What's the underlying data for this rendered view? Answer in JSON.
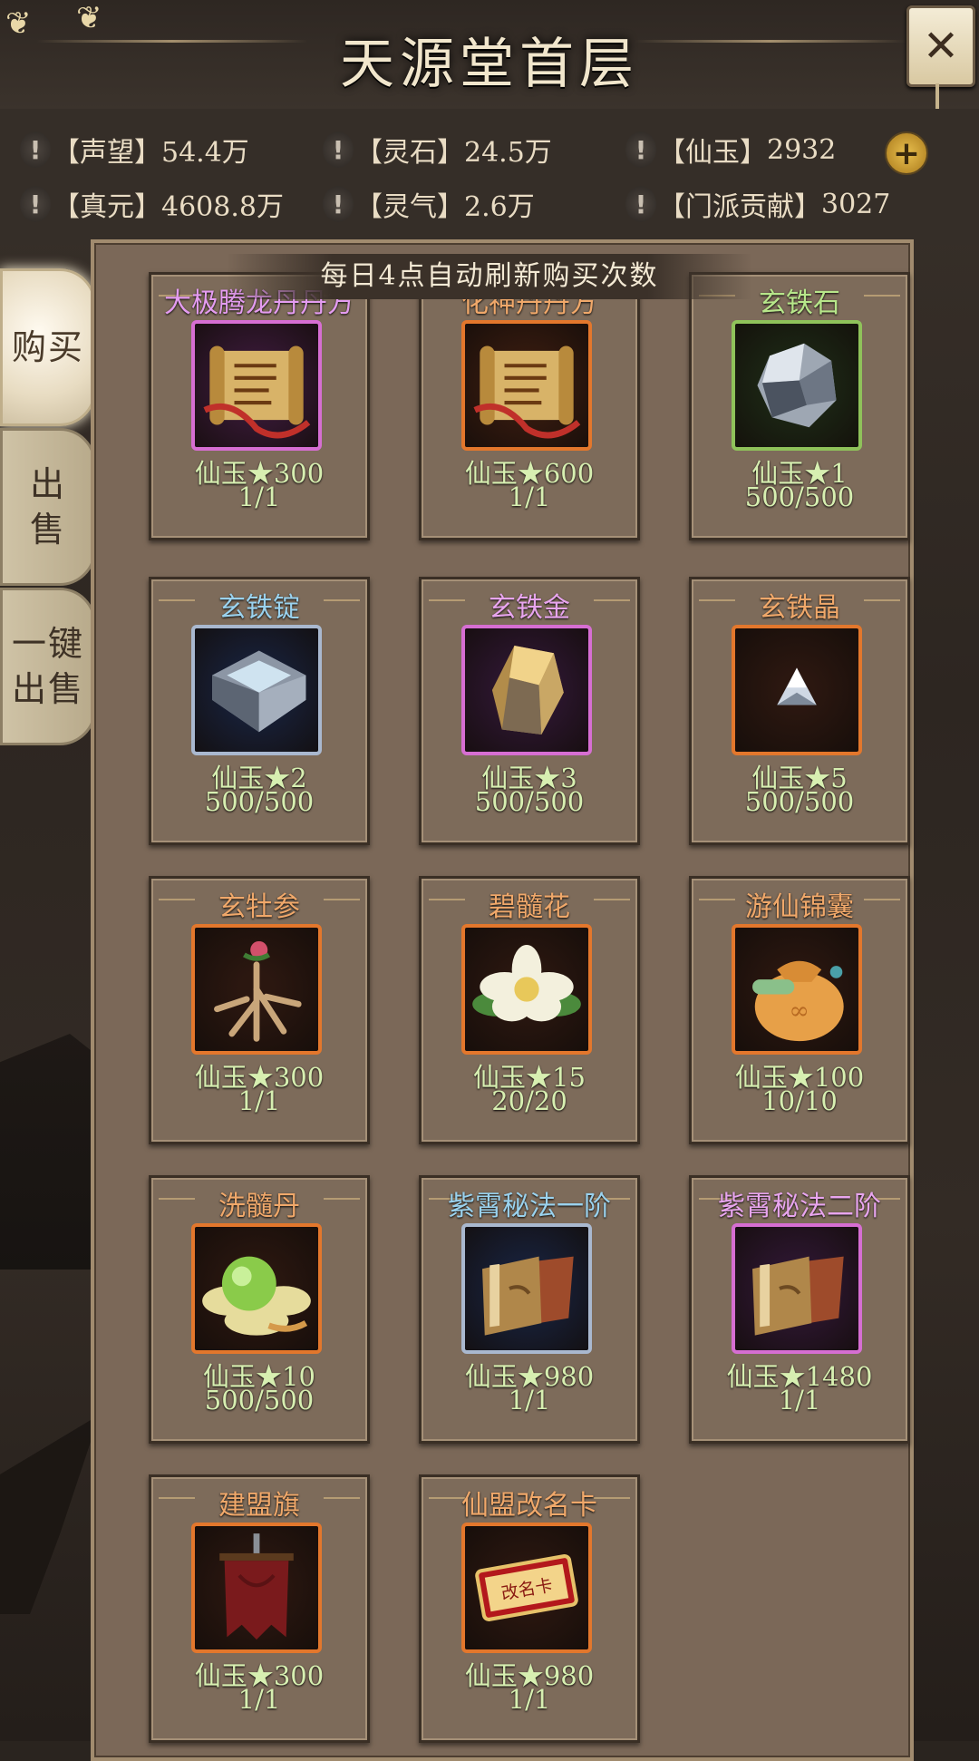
{
  "header": {
    "title": "天源堂首层",
    "close_label": "✕"
  },
  "resources": [
    {
      "name": "【声望】",
      "value": "54.4万"
    },
    {
      "name": "【灵石】",
      "value": "24.5万"
    },
    {
      "name": "【仙玉】",
      "value": "2932"
    },
    {
      "name": "【真元】",
      "value": "4608.8万"
    },
    {
      "name": "【灵气】",
      "value": "2.6万"
    },
    {
      "name": "【门派贡献】",
      "value": "3027"
    }
  ],
  "resource_alert_glyph": "!",
  "plus_label": "+",
  "tabs": {
    "buy": "购买",
    "sell": "出售",
    "onekey": "一键出售"
  },
  "tabs_lines": {
    "onekey_1": "一键",
    "onekey_2": "出售",
    "sell_1": "出",
    "sell_2": "售",
    "buy_1": "购",
    "buy_2": "买"
  },
  "notice": "每日4点自动刷新购买次数",
  "currency_label": "仙玉",
  "items": [
    {
      "name": "大极腾龙丹丹方",
      "price": "仙玉★300",
      "stock": "1/1",
      "name_color": "#e49cf0",
      "frame_color": "#d66ed2",
      "bg": "#3b1a3a",
      "icon": "scroll-icon"
    },
    {
      "name": "化神丹丹方",
      "price": "仙玉★600",
      "stock": "1/1",
      "name_color": "#f0a86a",
      "frame_color": "#e3772c",
      "bg": "#3a1c10",
      "icon": "scroll-icon"
    },
    {
      "name": "玄铁石",
      "price": "仙玉★1",
      "stock": "500/500",
      "name_color": "#b7e68a",
      "frame_color": "#8fc25a",
      "bg": "#1d2a16",
      "icon": "ore-icon"
    },
    {
      "name": "玄铁锭",
      "price": "仙玉★2",
      "stock": "500/500",
      "name_color": "#9ad2ee",
      "frame_color": "#a9b8cf",
      "bg": "#18223d",
      "icon": "ingot-icon"
    },
    {
      "name": "玄铁金",
      "price": "仙玉★3",
      "stock": "500/500",
      "name_color": "#e8a5ee",
      "frame_color": "#d66ed2",
      "bg": "#2f1733",
      "icon": "gold-ore-icon"
    },
    {
      "name": "玄铁晶",
      "price": "仙玉★5",
      "stock": "500/500",
      "name_color": "#f0a86a",
      "frame_color": "#e3772c",
      "bg": "#2b1710",
      "icon": "crystal-icon"
    },
    {
      "name": "玄牡参",
      "price": "仙玉★300",
      "stock": "1/1",
      "name_color": "#f0a86a",
      "frame_color": "#e3772c",
      "bg": "#2b1710",
      "icon": "ginseng-icon"
    },
    {
      "name": "碧髓花",
      "price": "仙玉★15",
      "stock": "20/20",
      "name_color": "#f0a86a",
      "frame_color": "#e3772c",
      "bg": "#2b1710",
      "icon": "flower-icon"
    },
    {
      "name": "游仙锦囊",
      "price": "仙玉★100",
      "stock": "10/10",
      "name_color": "#f0a86a",
      "frame_color": "#e3772c",
      "bg": "#2b1710",
      "icon": "pouch-icon"
    },
    {
      "name": "洗髓丹",
      "price": "仙玉★10",
      "stock": "500/500",
      "name_color": "#f0a86a",
      "frame_color": "#e3772c",
      "bg": "#2b1710",
      "icon": "pill-icon"
    },
    {
      "name": "紫霄秘法一阶",
      "price": "仙玉★980",
      "stock": "1/1",
      "name_color": "#9ad2ee",
      "frame_color": "#a9b8cf",
      "bg": "#18223d",
      "icon": "book-icon"
    },
    {
      "name": "紫霄秘法二阶",
      "price": "仙玉★1480",
      "stock": "1/1",
      "name_color": "#e8a5ee",
      "frame_color": "#d66ed2",
      "bg": "#2f1733",
      "icon": "book-icon"
    },
    {
      "name": "建盟旗",
      "price": "仙玉★300",
      "stock": "1/1",
      "name_color": "#f0a86a",
      "frame_color": "#e3772c",
      "bg": "#2b1710",
      "icon": "banner-icon"
    },
    {
      "name": "仙盟改名卡",
      "price": "仙玉★980",
      "stock": "1/1",
      "name_color": "#f0a86a",
      "frame_color": "#e3772c",
      "bg": "#2b1710",
      "icon": "rename-card-icon"
    }
  ],
  "rename_card_text": "改名卡"
}
